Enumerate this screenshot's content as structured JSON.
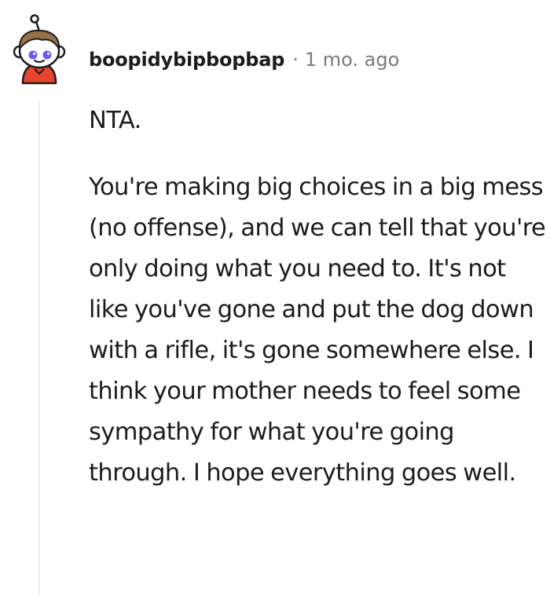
{
  "comment": {
    "avatar_icon": "snoo-avatar-icon",
    "username": "boopidybipbopbap",
    "separator": "·",
    "timestamp": "1 mo. ago",
    "paragraphs": [
      "NTA.",
      "You're making big choices in a big mess (no offense), and we can tell that you're only doing what you need to. It's not like you've gone and put the dog down with a rifle, it's gone somewhere else. I think your mother needs to feel some sympathy for what you're going through. I hope everything goes well."
    ]
  },
  "colors": {
    "text": "#1c1c1c",
    "meta": "#787c7e",
    "thread_line": "#edeff1",
    "avatar_shirt": "#e8442e",
    "avatar_hair": "#9a7147"
  }
}
